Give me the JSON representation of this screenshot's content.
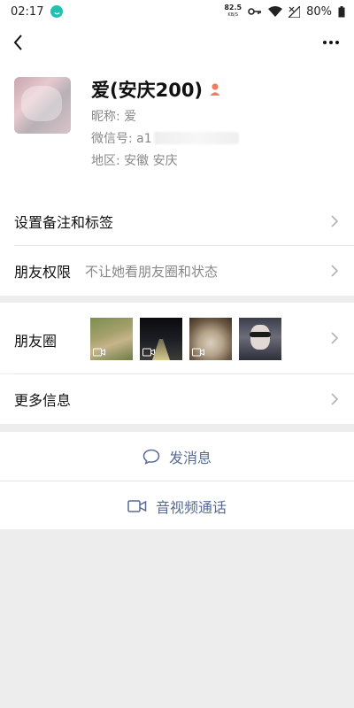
{
  "status_bar": {
    "time": "02:17",
    "net_speed_value": "82.5",
    "net_speed_unit": "KB/S",
    "battery": "80%"
  },
  "profile": {
    "name": "爱(安庆200)",
    "nickname": "昵称: 爱",
    "wechat_id_prefix": "微信号: a1",
    "region": "地区: 安徽  安庆"
  },
  "rows": {
    "remark_tags": "设置备注和标签",
    "privacy_label": "朋友权限",
    "privacy_desc": "不让她看朋友圈和状态",
    "moments_label": "朋友圈",
    "more_info": "更多信息"
  },
  "actions": {
    "send_message": "发消息",
    "video_call": "音视频通话"
  },
  "colors": {
    "link": "#576b95",
    "background": "#ededed",
    "gender_female": "#f07d5f"
  }
}
